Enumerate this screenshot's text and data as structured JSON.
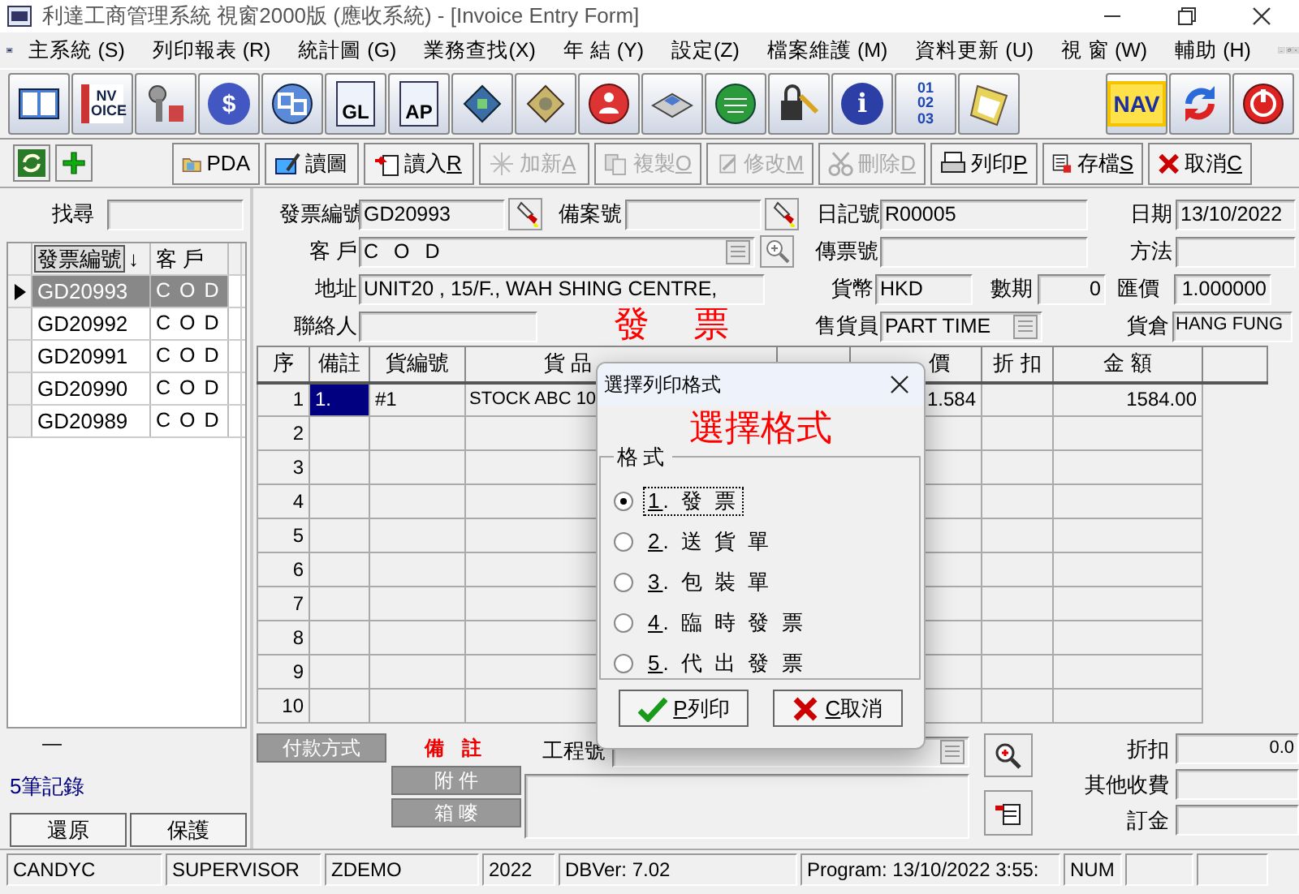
{
  "window": {
    "title": "利達工商管理系統 視窗2000版 (應收系統) - [Invoice Entry Form]"
  },
  "menu": [
    "主系統 (S)",
    "列印報表 (R)",
    "統計圖 (G)",
    "業務查找(X)",
    "年 結 (Y)",
    "設定(Z)",
    "檔案維護 (M)",
    "資料更新 (U)",
    "視 窗 (W)",
    "輔助 (H)"
  ],
  "toolbar_texts": [
    "NV OICE",
    "$",
    "GL",
    "AP",
    "i",
    "01 02 03",
    "NAV"
  ],
  "actions": [
    {
      "label": "PDA",
      "disabled": false
    },
    {
      "label": "讀圖",
      "disabled": false
    },
    {
      "label": "讀入",
      "key": "R",
      "disabled": false
    },
    {
      "label": "加新",
      "key": "A",
      "disabled": true
    },
    {
      "label": "複製",
      "key": "O",
      "disabled": true
    },
    {
      "label": "修改",
      "key": "M",
      "disabled": true
    },
    {
      "label": "刪除",
      "key": "D",
      "disabled": true
    },
    {
      "label": "列印",
      "key": "P",
      "disabled": false
    },
    {
      "label": "存檔",
      "key": "S",
      "disabled": false
    },
    {
      "label": "取消",
      "key": "C",
      "disabled": false
    }
  ],
  "search": {
    "label": "找尋"
  },
  "invoice_list": {
    "columns": [
      "發票編號",
      "客 戶"
    ],
    "sort_mark": "↓",
    "rows": [
      {
        "number": "GD20993",
        "customer": "C O D",
        "selected": true
      },
      {
        "number": "GD20992",
        "customer": "C O D",
        "selected": false
      },
      {
        "number": "GD20991",
        "customer": "C O D",
        "selected": false
      },
      {
        "number": "GD20990",
        "customer": "C O D",
        "selected": false
      },
      {
        "number": "GD20989",
        "customer": "C O D",
        "selected": false
      }
    ],
    "dash": "—",
    "record_count": "5筆記錄",
    "buttons": [
      "還原",
      "保護"
    ]
  },
  "form": {
    "title": "發 票",
    "fields": [
      {
        "label": "發票編號",
        "value": "GD20993",
        "kind": "pick"
      },
      {
        "label": "備案號",
        "kind": "pick"
      },
      {
        "label": "日記號",
        "value": "R00005",
        "kind": "text"
      },
      {
        "label": "日期",
        "value": "13/10/2022",
        "kind": "text"
      },
      {
        "label": "客 戶",
        "value": "C O D",
        "kind": "lookup_zoom"
      },
      {
        "label": "傳票號",
        "kind": "text"
      },
      {
        "label": "方法",
        "kind": "text"
      },
      {
        "label": "地址",
        "value": "UNIT20 , 15/F., WAH SHING CENTRE,",
        "kind": "text"
      },
      {
        "label": "貨幣",
        "value": "HKD",
        "kind": "text"
      },
      {
        "label": "數期",
        "value": "0",
        "kind": "number"
      },
      {
        "label": "匯價",
        "value": "1.000000",
        "kind": "number"
      },
      {
        "label": "聯絡人",
        "kind": "text"
      },
      {
        "label": "售貨員",
        "value": "PART TIME",
        "kind": "lookup"
      },
      {
        "label": "貨倉",
        "value": "HANG FUNG",
        "kind": "text"
      }
    ]
  },
  "table": {
    "columns": [
      "序",
      "備註",
      "貨編號",
      "貨 品",
      "價",
      "折 扣",
      "金 額"
    ],
    "rows": [
      {
        "no": "1",
        "note": "1.",
        "code": "#1",
        "item": "STOCK ABC 10",
        "price": "1.584",
        "amount": "1584.00",
        "selected": true
      },
      {
        "no": "2",
        "selected": false
      },
      {
        "no": "3",
        "selected": false
      },
      {
        "no": "4",
        "selected": false
      },
      {
        "no": "5",
        "selected": false
      },
      {
        "no": "6",
        "selected": false
      },
      {
        "no": "7",
        "selected": false
      },
      {
        "no": "8",
        "selected": false
      },
      {
        "no": "9",
        "selected": false
      },
      {
        "no": "10",
        "selected": false
      }
    ]
  },
  "bottom_tabs": [
    {
      "label": "付款方式",
      "selected": false
    },
    {
      "label": "備 註",
      "selected": true
    },
    {
      "label": "附 件",
      "selected": false
    },
    {
      "label": "箱 嘜",
      "selected": false
    }
  ],
  "project": {
    "label": "工程號"
  },
  "totals": [
    {
      "label": "折扣",
      "value": "0.0"
    },
    {
      "label": "其他收費"
    },
    {
      "label": "訂金"
    }
  ],
  "status_bar": [
    "CANDYC",
    "SUPERVISOR",
    "ZDEMO",
    "2022",
    "DBVer: 7.02",
    "Program: 13/10/2022 3:55:",
    "NUM"
  ],
  "dialog": {
    "title": "選擇列印格式",
    "heading": "選擇格式",
    "group": "格式",
    "options": [
      {
        "key": "1",
        "label": ". 發 票",
        "selected": true
      },
      {
        "key": "2",
        "label": ". 送 貨 單",
        "selected": false
      },
      {
        "key": "3",
        "label": ". 包 裝 單",
        "selected": false
      },
      {
        "key": "4",
        "label": ". 臨 時 發 票",
        "selected": false
      },
      {
        "key": "5",
        "label": ". 代 出 發 票",
        "selected": false
      }
    ],
    "buttons": [
      {
        "key": "P",
        "label": "列印",
        "kind": "ok"
      },
      {
        "key": "C",
        "label": "取消",
        "kind": "cancel"
      }
    ]
  }
}
